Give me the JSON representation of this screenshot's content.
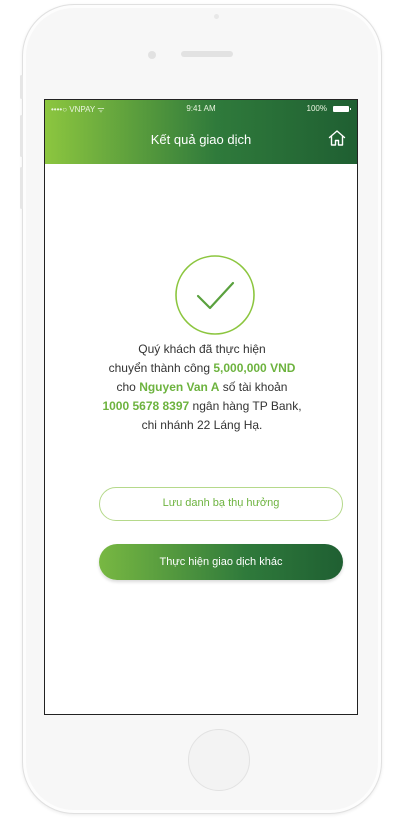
{
  "status_bar": {
    "carrier": "••••○ VNPAY ᯤ",
    "time": "9:41 AM",
    "battery": "100%"
  },
  "header": {
    "title": "Kết quả giao dịch",
    "home_icon": "home-icon"
  },
  "message": {
    "line1": "Quý khách đã thực hiện",
    "line2_prefix": "chuyển thành công ",
    "amount": "5,000,000 VND",
    "line3_prefix": "cho ",
    "recipient": "Nguyen Van A",
    "line3_suffix": " số tài khoản",
    "account": "1000 5678 8397",
    "line4_suffix": " ngân hàng TP Bank,",
    "line5": "chi nhánh 22 Láng Hạ."
  },
  "buttons": {
    "save_beneficiary": "Lưu danh bạ thụ hưởng",
    "new_transaction": "Thực hiện giao dịch khác"
  },
  "colors": {
    "accent_light": "#8cc63f",
    "accent_dark": "#1f5f32",
    "highlight": "#6db33f"
  }
}
